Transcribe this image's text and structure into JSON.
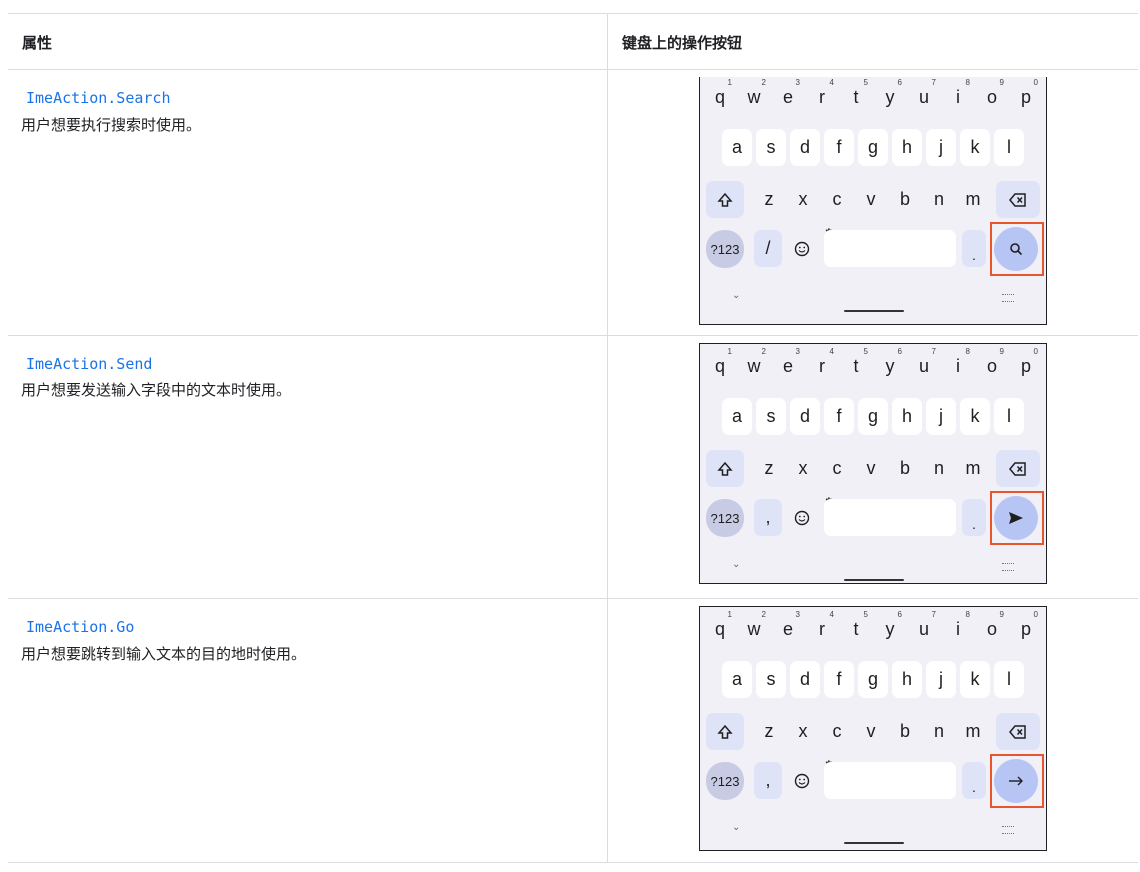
{
  "header": {
    "col_attribute": "属性",
    "col_button": "键盘上的操作按钮"
  },
  "rows": [
    {
      "action": "ImeAction.Search",
      "description": "用户想要执行搜索时使用。",
      "enter_icon": "search-icon",
      "punct_key": "/"
    },
    {
      "action": "ImeAction.Send",
      "description": "用户想要发送输入字段中的文本时使用。",
      "enter_icon": "send-icon",
      "punct_key": ","
    },
    {
      "action": "ImeAction.Go",
      "description": "用户想要跳转到输入文本的目的地时使用。",
      "enter_icon": "arrow-right-icon",
      "punct_key": ","
    }
  ],
  "keyboard": {
    "row1": [
      "q",
      "w",
      "e",
      "r",
      "t",
      "y",
      "u",
      "i",
      "o",
      "p"
    ],
    "row1_nums": [
      "1",
      "2",
      "3",
      "4",
      "5",
      "6",
      "7",
      "8",
      "9",
      "0"
    ],
    "row2": [
      "a",
      "s",
      "d",
      "f",
      "g",
      "h",
      "j",
      "k",
      "l"
    ],
    "row3": [
      "z",
      "x",
      "c",
      "v",
      "b",
      "n",
      "m"
    ],
    "symbols_key": "?123",
    "period_key": ".",
    "colors": {
      "background": "#f1f0f7",
      "enter": "#b7c5f5",
      "highlight": "#e8542b",
      "link": "#1a73e8"
    }
  }
}
